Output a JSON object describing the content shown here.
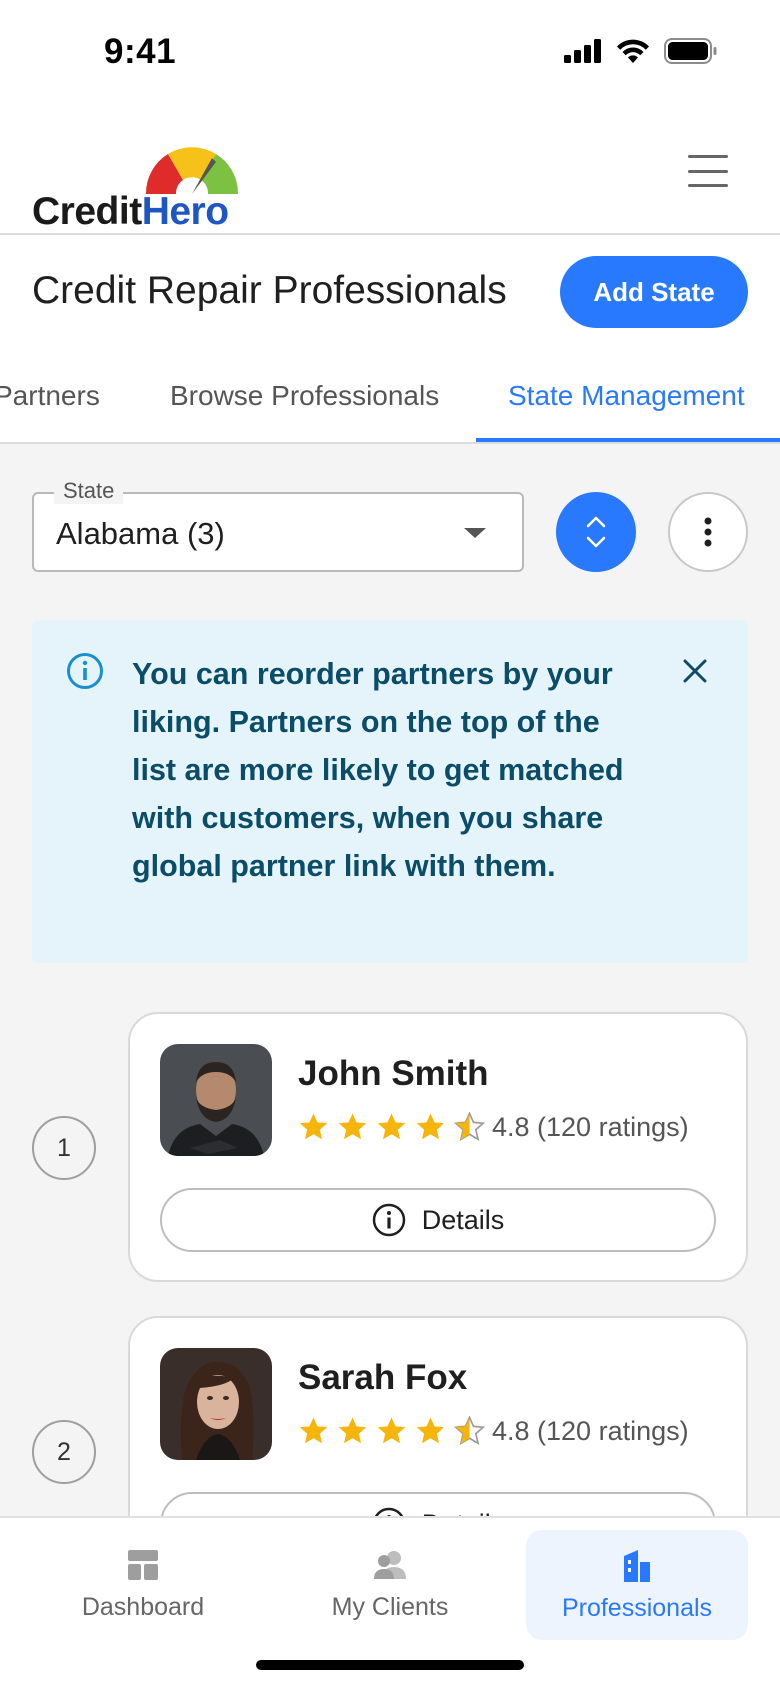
{
  "status_bar": {
    "time": "9:41"
  },
  "header": {
    "logo_credit": "Credit",
    "logo_hero": "Hero"
  },
  "page": {
    "title": "Credit Repair Professionals",
    "add_state_label": "Add State"
  },
  "tabs": [
    {
      "label": "Partners",
      "active": false
    },
    {
      "label": "Browse Professionals",
      "active": false
    },
    {
      "label": "State Management",
      "active": true
    }
  ],
  "state_select": {
    "label": "State",
    "value": "Alabama (3)"
  },
  "info_banner": {
    "text": "You can reorder partners by your liking. Partners on the top of the list are more likely to get matched with customers, when you share global partner link with them."
  },
  "professionals": [
    {
      "rank": "1",
      "name": "John Smith",
      "rating": 4.8,
      "rating_text": "4.8 (120 ratings)",
      "details_label": "Details"
    },
    {
      "rank": "2",
      "name": "Sarah Fox",
      "rating": 4.8,
      "rating_text": "4.8 (120 ratings)",
      "details_label": "Details"
    }
  ],
  "bottom_nav": [
    {
      "label": "Dashboard",
      "icon": "dashboard-icon",
      "active": false
    },
    {
      "label": "My Clients",
      "icon": "people-icon",
      "active": false
    },
    {
      "label": "Professionals",
      "icon": "building-icon",
      "active": true
    }
  ],
  "colors": {
    "accent": "#2979ff",
    "info_bg": "#e5f4fb",
    "info_text": "#0b4d69",
    "star": "#f5b50a"
  }
}
